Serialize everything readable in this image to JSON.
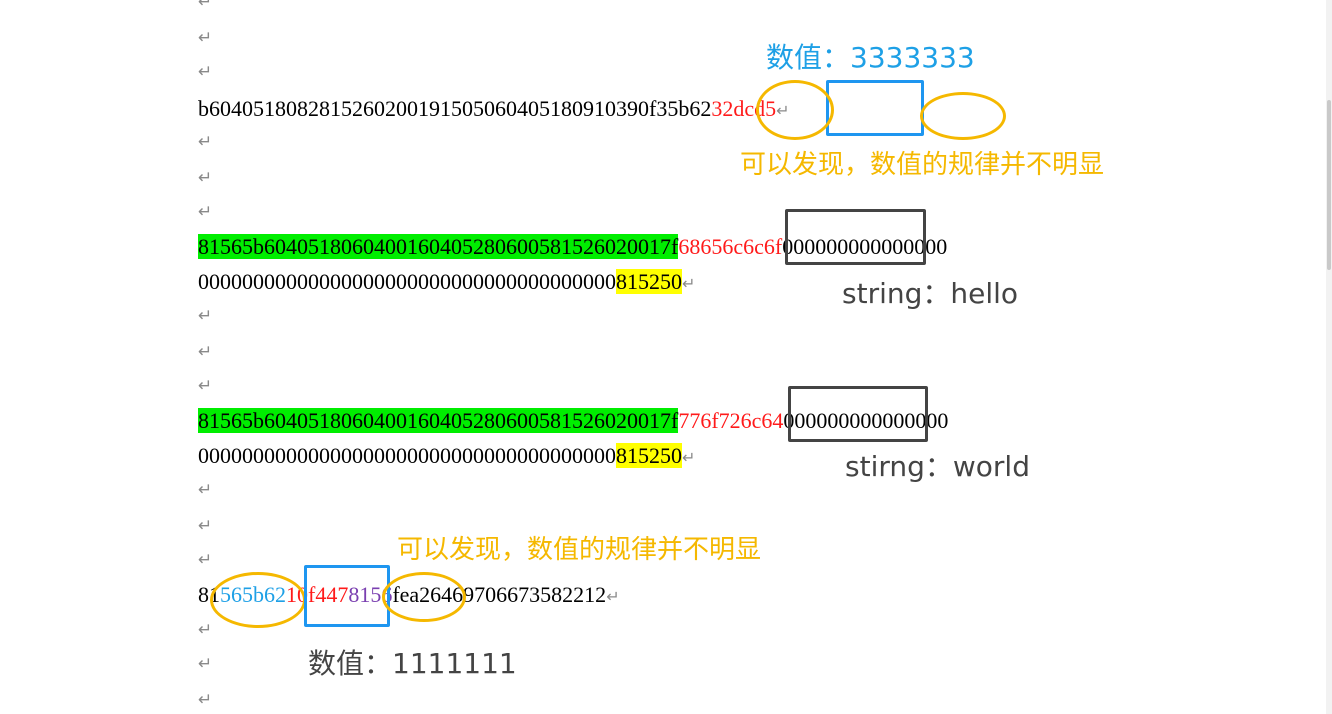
{
  "return_mark": "↵",
  "colors": {
    "green_highlight": "#00ee00",
    "yellow_highlight": "#ffff00",
    "red_text": "#ff1a1a",
    "blue_text": "#1ea0e6",
    "purple_text": "#7a3fb0",
    "annotation_orange": "#f5b800",
    "annotation_blue": "#1e96f0",
    "annotation_gray": "#444444"
  },
  "line1": {
    "plain": "b604051808281526020019150506040518091039",
    "circled": "0f35b62",
    "red": "32dcd5"
  },
  "line2": {
    "green": "81565b6040518060400160405280600581526020017f",
    "boxed_red": "68656c6c6f",
    "tail": "000000000000000",
    "row2_plain": "00000000000000000000000000000000000000",
    "row2_yellow": "815250"
  },
  "line3": {
    "green": "81565b6040518060400160405280600581526020017f",
    "boxed_red": "776f726c64",
    "tail": "000000000000000",
    "row2_plain": "00000000000000000000000000000000000000",
    "row2_yellow": "815250"
  },
  "line4": {
    "prefix": "81",
    "blue": "565b62",
    "red": "10f447",
    "purple": "8156",
    "rest": "fea26469706673582212"
  },
  "annotations": {
    "value_top": "数值：3333333",
    "finding_1": "可以发现，数值的规律并不明显",
    "string_hello": "string：hello",
    "string_world": "stirng：world",
    "finding_2": "可以发现，数值的规律并不明显",
    "value_bottom": "数值：1111111"
  }
}
